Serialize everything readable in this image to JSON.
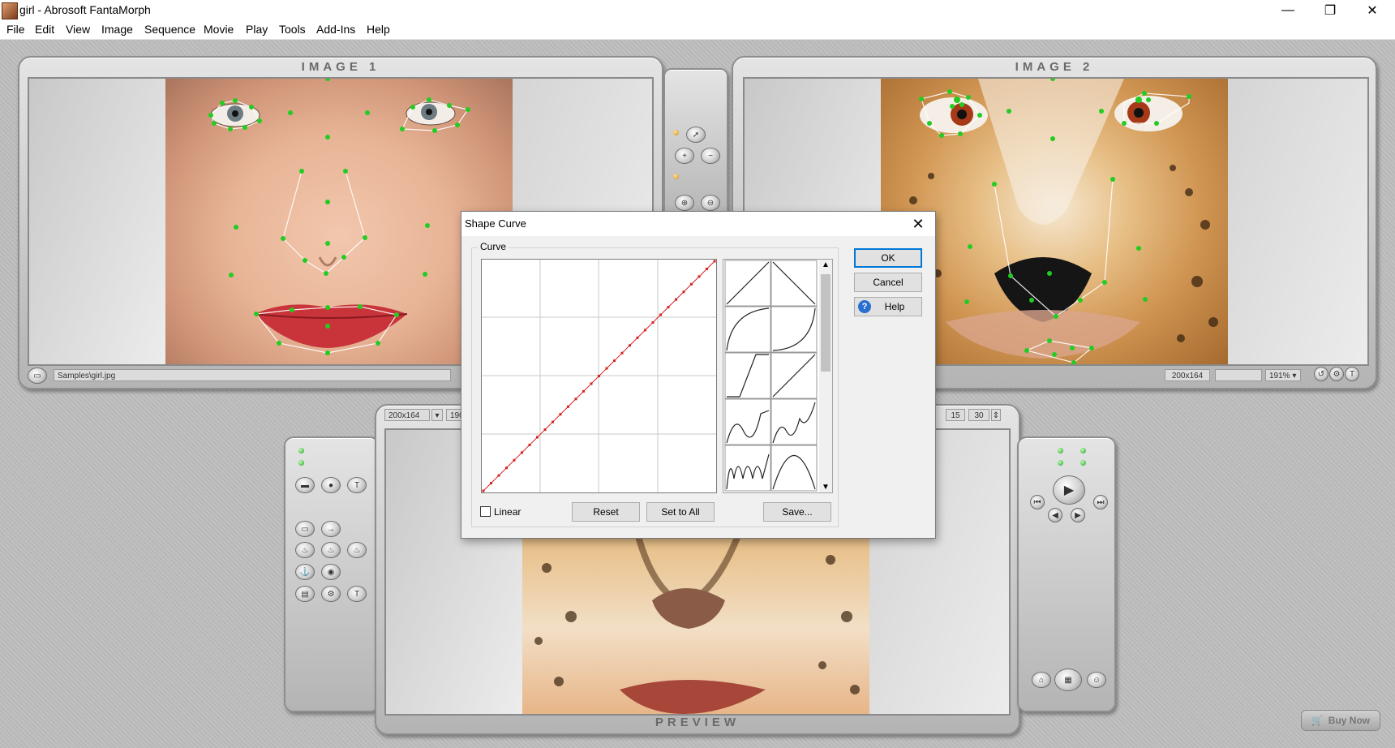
{
  "window": {
    "title": "girl - Abrosoft FantaMorph",
    "minimize_glyph": "—",
    "restore_glyph": "❐",
    "close_glyph": "✕"
  },
  "menu": [
    "File",
    "Edit",
    "View",
    "Image",
    "Sequence",
    "Movie",
    "Play",
    "Tools",
    "Add-Ins",
    "Help"
  ],
  "image1": {
    "title": "IMAGE 1",
    "path": "Samples\\girl.jpg"
  },
  "image2": {
    "title": "IMAGE 2",
    "size": "200x164",
    "zoom": "191%"
  },
  "preview": {
    "title": "PREVIEW",
    "size": "200x164",
    "size_partial": "190",
    "frame_a": "15",
    "frame_b": "30"
  },
  "dialog": {
    "title": "Shape Curve",
    "group_label": "Curve",
    "linear_label": "Linear",
    "linear_checked": false,
    "reset_label": "Reset",
    "set_to_all_label": "Set to All",
    "save_label": "Save...",
    "ok_label": "OK",
    "cancel_label": "Cancel",
    "help_label": "Help",
    "curve_color": "#d62020",
    "thumbnails": [
      "linear-up",
      "linear-down",
      "ease-out",
      "ease-in",
      "steep-early",
      "steep-late",
      "wave-2",
      "wave-3",
      "wave-4",
      "arch"
    ]
  },
  "buy_now_label": "Buy Now",
  "colors": {
    "control_point": "#22cc22",
    "mesh_line": "#ffffff"
  }
}
